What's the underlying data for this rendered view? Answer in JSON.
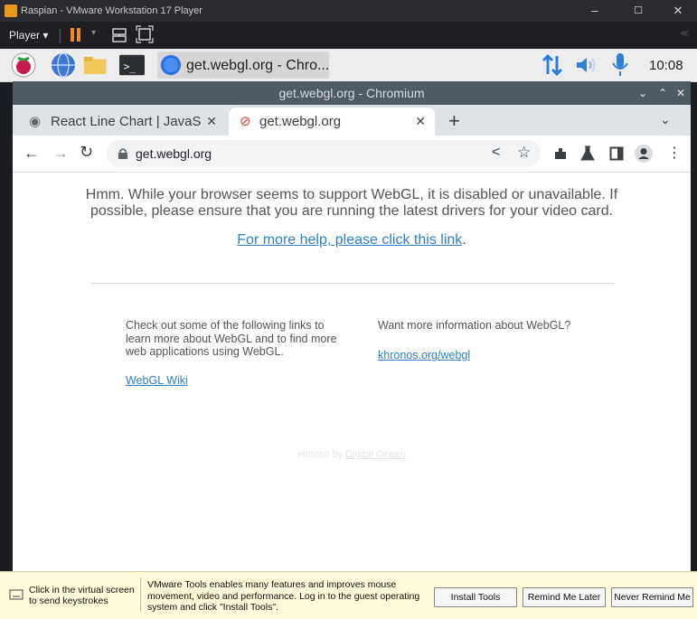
{
  "vm": {
    "title": "Raspian - VMware Workstation 17 Player",
    "player_label": "Player",
    "window_controls": [
      "–",
      "☐",
      "✕"
    ]
  },
  "taskbar": {
    "chromium_task_label": "get.webgl.org - Chro...",
    "clock": "10:08"
  },
  "chromium": {
    "window_title": "get.webgl.org - Chromium",
    "tabs": [
      {
        "label": "React Line Chart | JavaS",
        "active": false
      },
      {
        "label": "get.webgl.org",
        "active": true
      }
    ],
    "new_tab": "+",
    "url": "get.webgl.org"
  },
  "page": {
    "message": "Hmm. While your browser seems to support WebGL, it is disabled or unavailable. If possible, please ensure that you are running the latest drivers for your video card.",
    "help_link": "For more help, please click this link",
    "help_period": ".",
    "left_col_text": "Check out some of the following links to learn more about WebGL and to find more web applications using WebGL.",
    "left_col_link": "WebGL Wiki",
    "right_col_text": "Want more information about WebGL?",
    "right_col_link": "khronos.org/webgl",
    "hosted_by": "Hosted by ",
    "hosted_link": "Digital Ocean"
  },
  "vmtools": {
    "click_hint": "Click in the virtual screen to send keystrokes",
    "info": "VMware Tools enables many features and improves mouse movement, video and performance. Log in to the guest operating system and click \"Install Tools\".",
    "install": "Install Tools",
    "remind_later": "Remind Me Later",
    "never": "Never Remind Me"
  },
  "colors": {
    "link": "#2f7fc9",
    "chromium_title_bar": "#505a63",
    "pause_orange": "#f28b26"
  }
}
